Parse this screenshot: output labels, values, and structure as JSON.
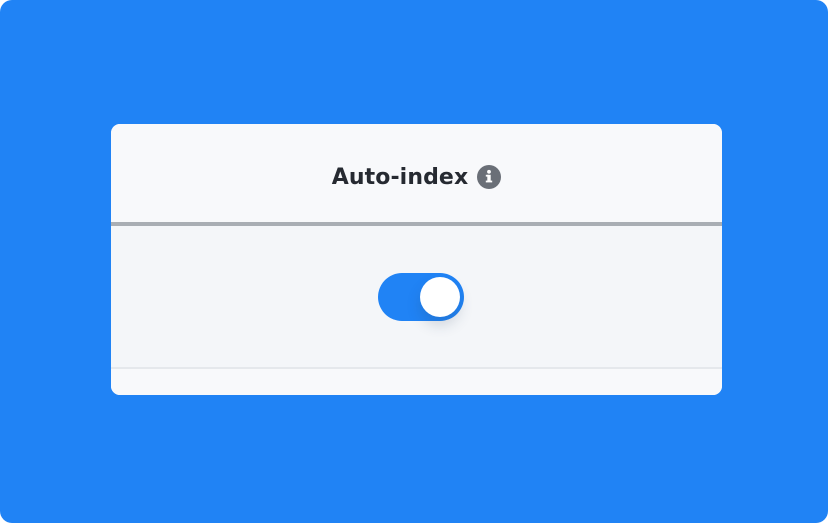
{
  "setting": {
    "title": "Auto-index",
    "info_icon": "info-circle-icon",
    "toggle": {
      "state": "on",
      "enabled": true
    }
  },
  "colors": {
    "background": "#2083f5",
    "toggle_on": "#2083f5",
    "card": "#f4f6f9",
    "title_text": "#262a31",
    "divider": "#a9aeb4"
  }
}
